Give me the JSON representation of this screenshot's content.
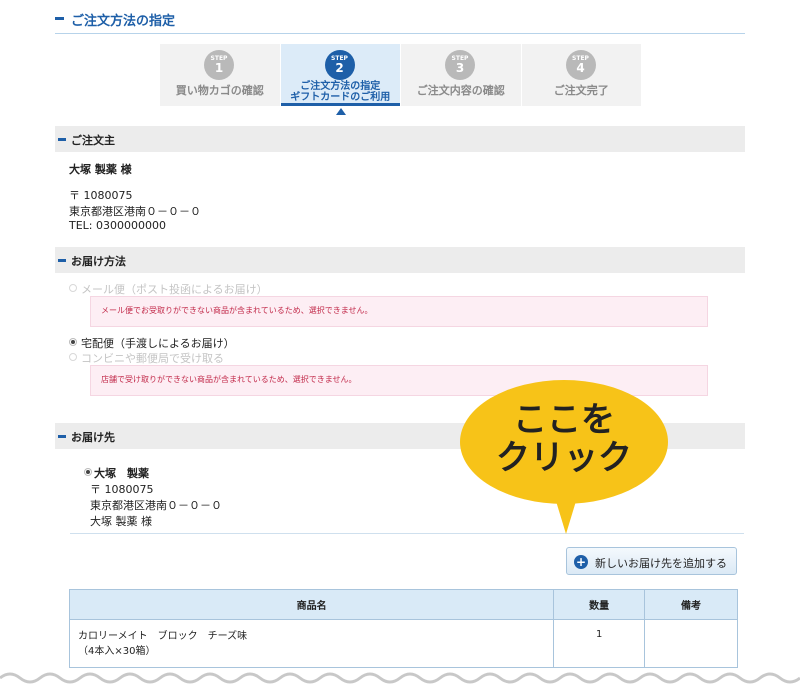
{
  "page": {
    "title": "ご注文方法の指定"
  },
  "steps": [
    {
      "step_label": "STEP",
      "number": "1",
      "label": "買い物カゴの確認"
    },
    {
      "step_label": "STEP",
      "number": "2",
      "label_line1": "ご注文方法の指定",
      "label_line2": "ギフトカードのご利用"
    },
    {
      "step_label": "STEP",
      "number": "3",
      "label": "ご注文内容の確認"
    },
    {
      "step_label": "STEP",
      "number": "4",
      "label": "ご注文完了"
    }
  ],
  "orderer": {
    "heading": "ご注文主",
    "name": "大塚 製薬 様",
    "postal": "〒 1080075",
    "address": "東京都港区港南０－０－０",
    "tel": "TEL: 0300000000"
  },
  "delivery_method": {
    "heading": "お届け方法",
    "option_mail": "メール便（ポスト投函によるお届け）",
    "notice_mail": "メール便でお受取りができない商品が含まれているため、選択できません。",
    "option_home": "宅配便（手渡しによるお届け）",
    "option_store": "コンビニや郵便局で受け取る",
    "notice_store": "店舗で受け取りができない商品が含まれているため、選択できません。"
  },
  "destination": {
    "heading": "お届け先",
    "name": "大塚　製薬",
    "postal": "〒 1080075",
    "address": "東京都港区港南０－０－０",
    "recipient": "大塚 製薬 様",
    "add_button": "新しいお届け先を追加する"
  },
  "callout": {
    "line1": "ここを",
    "line2": "クリック"
  },
  "table": {
    "headers": {
      "product": "商品名",
      "quantity": "数量",
      "remarks": "備考"
    },
    "rows": [
      {
        "name_line1": "カロリーメイト　ブロック　チーズ味",
        "name_line2": "（4本入×30箱）",
        "quantity": "1",
        "remarks": ""
      }
    ]
  },
  "colors": {
    "accent": "#1e5fa8",
    "callout": "#f7c318",
    "notice_text": "#c22a4a",
    "notice_bg": "#fdeef4"
  }
}
